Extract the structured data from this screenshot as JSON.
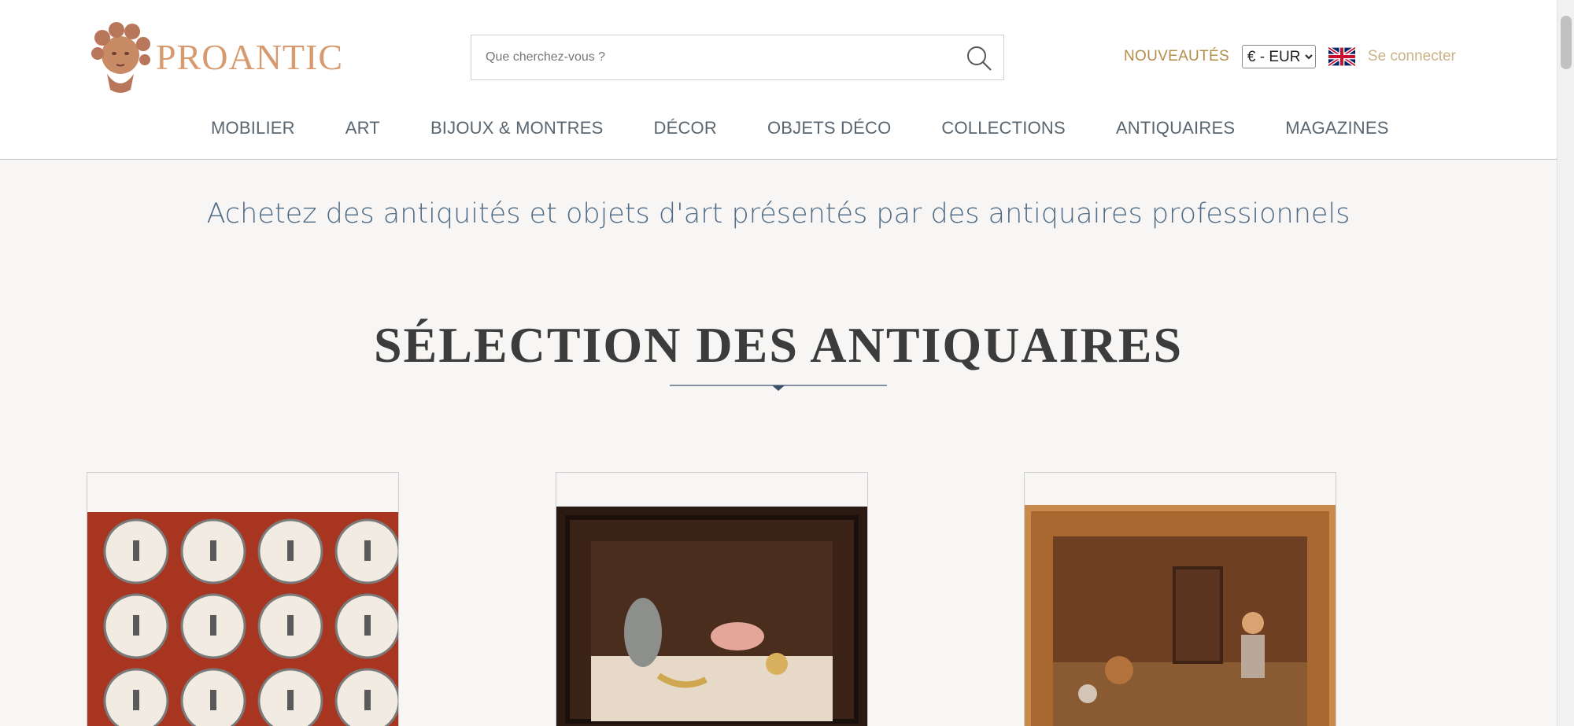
{
  "header": {
    "logo_text": "PROANTIC",
    "search": {
      "placeholder": "Que cherchez-vous ?"
    },
    "nouveautes_label": "NOUVEAUTÉS",
    "currency": {
      "selected": "€ - EUR"
    },
    "language_flag": "uk-flag-icon",
    "login_label": "Se connecter"
  },
  "nav": {
    "items": [
      "MOBILIER",
      "ART",
      "BIJOUX & MONTRES",
      "DÉCOR",
      "OBJETS DÉCO",
      "COLLECTIONS",
      "ANTIQUAIRES",
      "MAGAZINES"
    ]
  },
  "main": {
    "tagline": "Achetez des antiquités et objets d'art présentés par des antiquaires professionnels",
    "section_title": "SÉLECTION DES ANTIQUAIRES"
  },
  "colors": {
    "accent_gold": "#b38c4a",
    "logo": "#d69a6e",
    "nav_text": "#5a6670",
    "tagline": "#4f6b86"
  }
}
